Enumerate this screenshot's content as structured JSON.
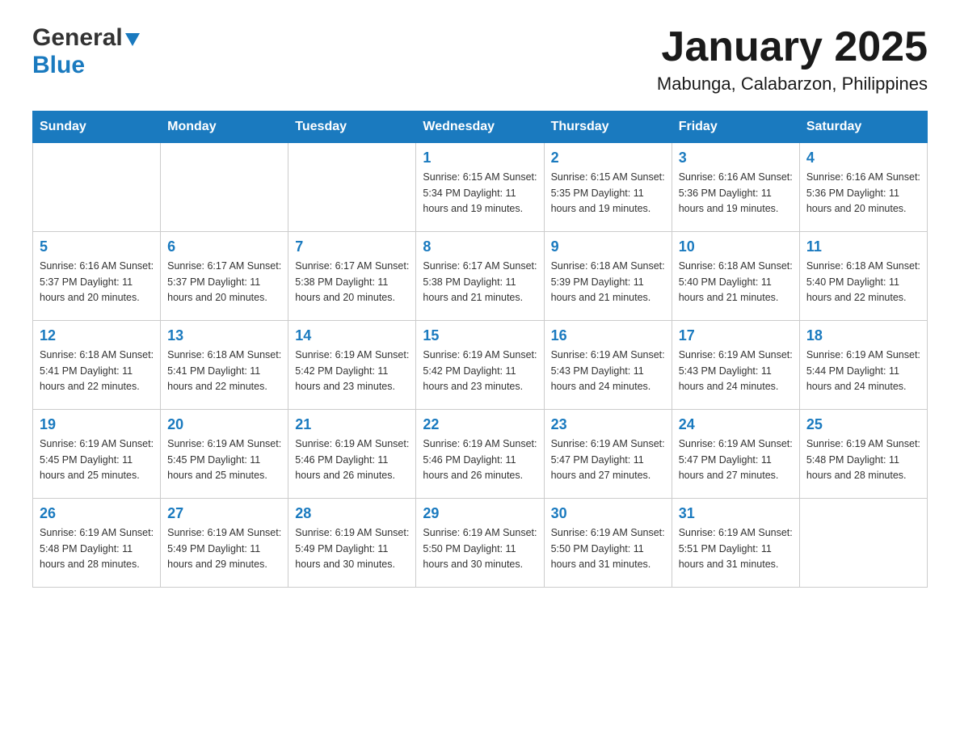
{
  "header": {
    "logo": {
      "general_text": "General",
      "blue_text": "Blue"
    },
    "title": "January 2025",
    "location": "Mabunga, Calabarzon, Philippines"
  },
  "calendar": {
    "weekdays": [
      "Sunday",
      "Monday",
      "Tuesday",
      "Wednesday",
      "Thursday",
      "Friday",
      "Saturday"
    ],
    "weeks": [
      [
        {
          "day": "",
          "info": ""
        },
        {
          "day": "",
          "info": ""
        },
        {
          "day": "",
          "info": ""
        },
        {
          "day": "1",
          "info": "Sunrise: 6:15 AM\nSunset: 5:34 PM\nDaylight: 11 hours\nand 19 minutes."
        },
        {
          "day": "2",
          "info": "Sunrise: 6:15 AM\nSunset: 5:35 PM\nDaylight: 11 hours\nand 19 minutes."
        },
        {
          "day": "3",
          "info": "Sunrise: 6:16 AM\nSunset: 5:36 PM\nDaylight: 11 hours\nand 19 minutes."
        },
        {
          "day": "4",
          "info": "Sunrise: 6:16 AM\nSunset: 5:36 PM\nDaylight: 11 hours\nand 20 minutes."
        }
      ],
      [
        {
          "day": "5",
          "info": "Sunrise: 6:16 AM\nSunset: 5:37 PM\nDaylight: 11 hours\nand 20 minutes."
        },
        {
          "day": "6",
          "info": "Sunrise: 6:17 AM\nSunset: 5:37 PM\nDaylight: 11 hours\nand 20 minutes."
        },
        {
          "day": "7",
          "info": "Sunrise: 6:17 AM\nSunset: 5:38 PM\nDaylight: 11 hours\nand 20 minutes."
        },
        {
          "day": "8",
          "info": "Sunrise: 6:17 AM\nSunset: 5:38 PM\nDaylight: 11 hours\nand 21 minutes."
        },
        {
          "day": "9",
          "info": "Sunrise: 6:18 AM\nSunset: 5:39 PM\nDaylight: 11 hours\nand 21 minutes."
        },
        {
          "day": "10",
          "info": "Sunrise: 6:18 AM\nSunset: 5:40 PM\nDaylight: 11 hours\nand 21 minutes."
        },
        {
          "day": "11",
          "info": "Sunrise: 6:18 AM\nSunset: 5:40 PM\nDaylight: 11 hours\nand 22 minutes."
        }
      ],
      [
        {
          "day": "12",
          "info": "Sunrise: 6:18 AM\nSunset: 5:41 PM\nDaylight: 11 hours\nand 22 minutes."
        },
        {
          "day": "13",
          "info": "Sunrise: 6:18 AM\nSunset: 5:41 PM\nDaylight: 11 hours\nand 22 minutes."
        },
        {
          "day": "14",
          "info": "Sunrise: 6:19 AM\nSunset: 5:42 PM\nDaylight: 11 hours\nand 23 minutes."
        },
        {
          "day": "15",
          "info": "Sunrise: 6:19 AM\nSunset: 5:42 PM\nDaylight: 11 hours\nand 23 minutes."
        },
        {
          "day": "16",
          "info": "Sunrise: 6:19 AM\nSunset: 5:43 PM\nDaylight: 11 hours\nand 24 minutes."
        },
        {
          "day": "17",
          "info": "Sunrise: 6:19 AM\nSunset: 5:43 PM\nDaylight: 11 hours\nand 24 minutes."
        },
        {
          "day": "18",
          "info": "Sunrise: 6:19 AM\nSunset: 5:44 PM\nDaylight: 11 hours\nand 24 minutes."
        }
      ],
      [
        {
          "day": "19",
          "info": "Sunrise: 6:19 AM\nSunset: 5:45 PM\nDaylight: 11 hours\nand 25 minutes."
        },
        {
          "day": "20",
          "info": "Sunrise: 6:19 AM\nSunset: 5:45 PM\nDaylight: 11 hours\nand 25 minutes."
        },
        {
          "day": "21",
          "info": "Sunrise: 6:19 AM\nSunset: 5:46 PM\nDaylight: 11 hours\nand 26 minutes."
        },
        {
          "day": "22",
          "info": "Sunrise: 6:19 AM\nSunset: 5:46 PM\nDaylight: 11 hours\nand 26 minutes."
        },
        {
          "day": "23",
          "info": "Sunrise: 6:19 AM\nSunset: 5:47 PM\nDaylight: 11 hours\nand 27 minutes."
        },
        {
          "day": "24",
          "info": "Sunrise: 6:19 AM\nSunset: 5:47 PM\nDaylight: 11 hours\nand 27 minutes."
        },
        {
          "day": "25",
          "info": "Sunrise: 6:19 AM\nSunset: 5:48 PM\nDaylight: 11 hours\nand 28 minutes."
        }
      ],
      [
        {
          "day": "26",
          "info": "Sunrise: 6:19 AM\nSunset: 5:48 PM\nDaylight: 11 hours\nand 28 minutes."
        },
        {
          "day": "27",
          "info": "Sunrise: 6:19 AM\nSunset: 5:49 PM\nDaylight: 11 hours\nand 29 minutes."
        },
        {
          "day": "28",
          "info": "Sunrise: 6:19 AM\nSunset: 5:49 PM\nDaylight: 11 hours\nand 30 minutes."
        },
        {
          "day": "29",
          "info": "Sunrise: 6:19 AM\nSunset: 5:50 PM\nDaylight: 11 hours\nand 30 minutes."
        },
        {
          "day": "30",
          "info": "Sunrise: 6:19 AM\nSunset: 5:50 PM\nDaylight: 11 hours\nand 31 minutes."
        },
        {
          "day": "31",
          "info": "Sunrise: 6:19 AM\nSunset: 5:51 PM\nDaylight: 11 hours\nand 31 minutes."
        },
        {
          "day": "",
          "info": ""
        }
      ]
    ]
  }
}
